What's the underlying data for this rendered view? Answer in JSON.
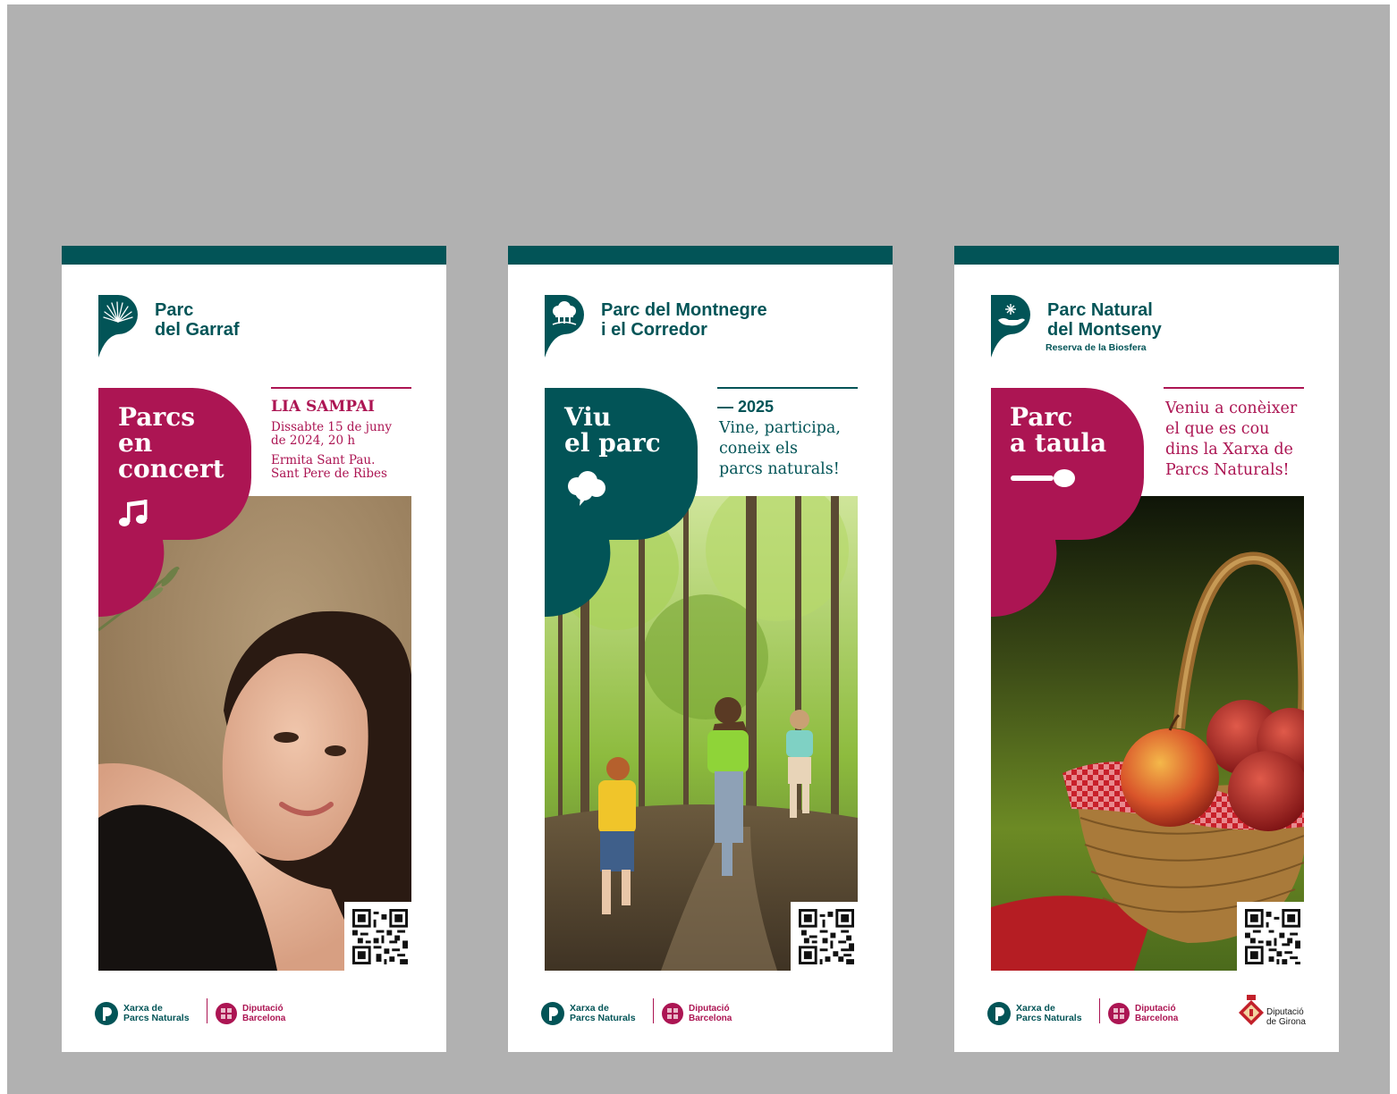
{
  "colors": {
    "teal": "#025457",
    "magenta": "#ac1553",
    "background": "#b1b1b1"
  },
  "posters": [
    {
      "park_name": "Parc\ndel Garraf",
      "park_sub": "",
      "title": "Parcs\nen\nconcert",
      "icon": "music-note-icon",
      "headline": "LIA SAMPAI",
      "details": [
        "Dissabte 15 de juny\nde 2024, 20 h",
        "Ermita Sant Pau.\nSant Pere de Ribes"
      ],
      "photo": "woman-portrait-photo"
    },
    {
      "park_name": "Parc del Montnegre\ni el Corredor",
      "park_sub": "",
      "title": "Viu\nel parc",
      "icon": "speech-cloud-icon",
      "headline": "— 2025",
      "text": "Vine, participa,\nconeix els\nparcs naturals!",
      "photo": "children-in-forest-photo"
    },
    {
      "park_name": "Parc Natural\ndel Montseny",
      "park_sub": "Reserva de la Biosfera",
      "title": "Parc\na taula",
      "icon": "spoon-icon",
      "text": "Veniu a conèixer\nel que es cou\ndins la Xarxa de\nParcs Naturals!",
      "photo": "apple-basket-photo"
    }
  ],
  "footer": {
    "xarxa": "Xarxa de\nParcs Naturals",
    "diputacio_barcelona": "Diputació\nBarcelona",
    "diputacio_girona": "Diputació\nde Girona"
  }
}
